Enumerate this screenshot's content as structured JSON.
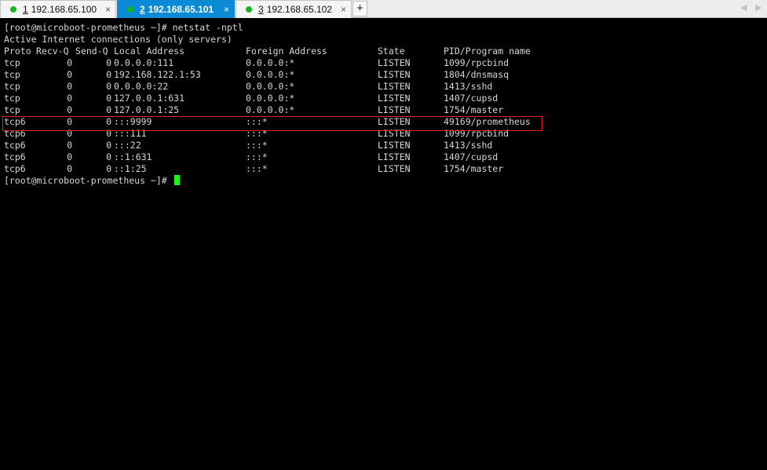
{
  "tabs": [
    {
      "num": "1",
      "host": "192.168.65.100",
      "active": false,
      "close": "×"
    },
    {
      "num": "2",
      "host": "192.168.65.101",
      "active": true,
      "close": "×"
    },
    {
      "num": "3",
      "host": "192.168.65.102",
      "active": false,
      "close": "×"
    }
  ],
  "add_tab_label": "+",
  "nav": {
    "prev": "◀",
    "next": "▶"
  },
  "terminal": {
    "command_line": "[root@microboot-prometheus ~]# netstat -nptl",
    "subtitle": "Active Internet connections (only servers)",
    "headers": [
      "Proto",
      "Recv-Q",
      "Send-Q",
      "Local Address",
      "Foreign Address",
      "State",
      "PID/Program name"
    ],
    "rows": [
      [
        "tcp",
        "0",
        "0",
        "0.0.0.0:111",
        "0.0.0.0:*",
        "LISTEN",
        "1099/rpcbind"
      ],
      [
        "tcp",
        "0",
        "0",
        "192.168.122.1:53",
        "0.0.0.0:*",
        "LISTEN",
        "1804/dnsmasq"
      ],
      [
        "tcp",
        "0",
        "0",
        "0.0.0.0:22",
        "0.0.0.0:*",
        "LISTEN",
        "1413/sshd"
      ],
      [
        "tcp",
        "0",
        "0",
        "127.0.0.1:631",
        "0.0.0.0:*",
        "LISTEN",
        "1407/cupsd"
      ],
      [
        "tcp",
        "0",
        "0",
        "127.0.0.1:25",
        "0.0.0.0:*",
        "LISTEN",
        "1754/master"
      ],
      [
        "tcp6",
        "0",
        "0",
        ":::9999",
        ":::*",
        "LISTEN",
        "49169/prometheus"
      ],
      [
        "tcp6",
        "0",
        "0",
        ":::111",
        ":::*",
        "LISTEN",
        "1099/rpcbind"
      ],
      [
        "tcp6",
        "0",
        "0",
        ":::22",
        ":::*",
        "LISTEN",
        "1413/sshd"
      ],
      [
        "tcp6",
        "0",
        "0",
        "::1:631",
        ":::*",
        "LISTEN",
        "1407/cupsd"
      ],
      [
        "tcp6",
        "0",
        "0",
        "::1:25",
        ":::*",
        "LISTEN",
        "1754/master"
      ]
    ],
    "highlighted_row": 5,
    "prompt": "[root@microboot-prometheus ~]# "
  },
  "colors": {
    "terminal_bg": "#000000",
    "terminal_text": "#d6d6d6",
    "active_tab": "#0b8ad6",
    "status_dot": "#17b424",
    "highlight_border": "#e02424",
    "cursor": "#1df31d"
  }
}
